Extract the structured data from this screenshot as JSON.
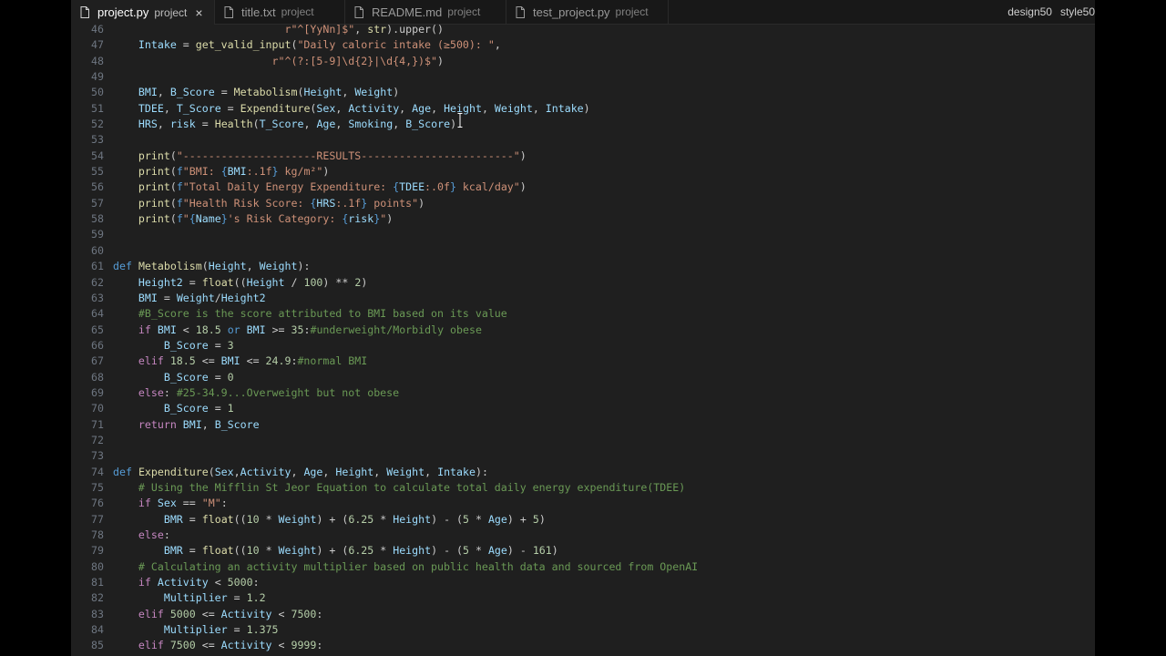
{
  "tabs": [
    {
      "name": "project.py",
      "desc": "project",
      "active": true
    },
    {
      "name": "title.txt",
      "desc": "project",
      "active": false
    },
    {
      "name": "README.md",
      "desc": "project",
      "active": false
    },
    {
      "name": "test_project.py",
      "desc": "project",
      "active": false
    }
  ],
  "header_right": [
    "design50",
    "style50"
  ],
  "close_glyph": "×",
  "code_lines": [
    {
      "n": "46",
      "t": [
        [
          "s",
          "                           r\"^[YyNn]$\""
        ],
        [
          "p",
          ", "
        ],
        [
          "f",
          "str"
        ],
        [
          "p",
          ").upper()"
        ]
      ]
    },
    {
      "n": "47",
      "t": [
        [
          "p",
          "    "
        ],
        [
          "v",
          "Intake"
        ],
        [
          "p",
          " = "
        ],
        [
          "f",
          "get_valid_input"
        ],
        [
          "p",
          "("
        ],
        [
          "s",
          "\"Daily caloric intake (≥500): \""
        ],
        [
          "p",
          ","
        ]
      ]
    },
    {
      "n": "48",
      "t": [
        [
          "p",
          "                         "
        ],
        [
          "s",
          "r\"^(?:[5-9]\\d{2}|\\d{4,})$\""
        ],
        [
          "p",
          ")"
        ]
      ]
    },
    {
      "n": "49",
      "t": []
    },
    {
      "n": "50",
      "t": [
        [
          "p",
          "    "
        ],
        [
          "v",
          "BMI"
        ],
        [
          "p",
          ", "
        ],
        [
          "v",
          "B_Score"
        ],
        [
          "p",
          " = "
        ],
        [
          "f",
          "Metabolism"
        ],
        [
          "p",
          "("
        ],
        [
          "v",
          "Height"
        ],
        [
          "p",
          ", "
        ],
        [
          "v",
          "Weight"
        ],
        [
          "p",
          ")"
        ]
      ]
    },
    {
      "n": "51",
      "t": [
        [
          "p",
          "    "
        ],
        [
          "v",
          "TDEE"
        ],
        [
          "p",
          ", "
        ],
        [
          "v",
          "T_Score"
        ],
        [
          "p",
          " = "
        ],
        [
          "f",
          "Expenditure"
        ],
        [
          "p",
          "("
        ],
        [
          "v",
          "Sex"
        ],
        [
          "p",
          ", "
        ],
        [
          "v",
          "Activity"
        ],
        [
          "p",
          ", "
        ],
        [
          "v",
          "Age"
        ],
        [
          "p",
          ", "
        ],
        [
          "v",
          "Height"
        ],
        [
          "p",
          ", "
        ],
        [
          "v",
          "Weight"
        ],
        [
          "p",
          ", "
        ],
        [
          "v",
          "Intake"
        ],
        [
          "p",
          ")"
        ]
      ]
    },
    {
      "n": "52",
      "t": [
        [
          "p",
          "    "
        ],
        [
          "v",
          "HRS"
        ],
        [
          "p",
          ", "
        ],
        [
          "v",
          "risk"
        ],
        [
          "p",
          " = "
        ],
        [
          "f",
          "Health"
        ],
        [
          "p",
          "("
        ],
        [
          "v",
          "T_Score"
        ],
        [
          "p",
          ", "
        ],
        [
          "v",
          "Age"
        ],
        [
          "p",
          ", "
        ],
        [
          "v",
          "Smoking"
        ],
        [
          "p",
          ", "
        ],
        [
          "v",
          "B_Score"
        ],
        [
          "p",
          ")"
        ]
      ]
    },
    {
      "n": "53",
      "t": []
    },
    {
      "n": "54",
      "t": [
        [
          "p",
          "    "
        ],
        [
          "f",
          "print"
        ],
        [
          "p",
          "("
        ],
        [
          "s",
          "\"---------------------RESULTS------------------------\""
        ],
        [
          "p",
          ")"
        ]
      ]
    },
    {
      "n": "55",
      "t": [
        [
          "p",
          "    "
        ],
        [
          "f",
          "print"
        ],
        [
          "p",
          "("
        ],
        [
          "k",
          "f"
        ],
        [
          "s",
          "\"BMI: "
        ],
        [
          "k",
          "{"
        ],
        [
          "v",
          "BMI"
        ],
        [
          "s",
          ":.1f"
        ],
        [
          "k",
          "}"
        ],
        [
          "s",
          " kg/m²\""
        ],
        [
          "p",
          ")"
        ]
      ]
    },
    {
      "n": "56",
      "t": [
        [
          "p",
          "    "
        ],
        [
          "f",
          "print"
        ],
        [
          "p",
          "("
        ],
        [
          "k",
          "f"
        ],
        [
          "s",
          "\"Total Daily Energy Expenditure: "
        ],
        [
          "k",
          "{"
        ],
        [
          "v",
          "TDEE"
        ],
        [
          "s",
          ":.0f"
        ],
        [
          "k",
          "}"
        ],
        [
          "s",
          " kcal/day\""
        ],
        [
          "p",
          ")"
        ]
      ]
    },
    {
      "n": "57",
      "t": [
        [
          "p",
          "    "
        ],
        [
          "f",
          "print"
        ],
        [
          "p",
          "("
        ],
        [
          "k",
          "f"
        ],
        [
          "s",
          "\"Health Risk Score: "
        ],
        [
          "k",
          "{"
        ],
        [
          "v",
          "HRS"
        ],
        [
          "s",
          ":.1f"
        ],
        [
          "k",
          "}"
        ],
        [
          "s",
          " points\""
        ],
        [
          "p",
          ")"
        ]
      ]
    },
    {
      "n": "58",
      "t": [
        [
          "p",
          "    "
        ],
        [
          "f",
          "print"
        ],
        [
          "p",
          "("
        ],
        [
          "k",
          "f"
        ],
        [
          "s",
          "\""
        ],
        [
          "k",
          "{"
        ],
        [
          "v",
          "Name"
        ],
        [
          "k",
          "}"
        ],
        [
          "s",
          "'s Risk Category: "
        ],
        [
          "k",
          "{"
        ],
        [
          "v",
          "risk"
        ],
        [
          "k",
          "}"
        ],
        [
          "s",
          "\""
        ],
        [
          "p",
          ")"
        ]
      ]
    },
    {
      "n": "59",
      "t": []
    },
    {
      "n": "60",
      "t": []
    },
    {
      "n": "61",
      "t": [
        [
          "k",
          "def"
        ],
        [
          "p",
          " "
        ],
        [
          "f",
          "Metabolism"
        ],
        [
          "p",
          "("
        ],
        [
          "v",
          "Height"
        ],
        [
          "p",
          ", "
        ],
        [
          "v",
          "Weight"
        ],
        [
          "p",
          "):"
        ]
      ]
    },
    {
      "n": "62",
      "t": [
        [
          "p",
          "    "
        ],
        [
          "v",
          "Height2"
        ],
        [
          "p",
          " = "
        ],
        [
          "f",
          "float"
        ],
        [
          "p",
          "(("
        ],
        [
          "v",
          "Height"
        ],
        [
          "p",
          " / "
        ],
        [
          "n",
          "100"
        ],
        [
          "p",
          ") ** "
        ],
        [
          "n",
          "2"
        ],
        [
          "p",
          ")"
        ]
      ]
    },
    {
      "n": "63",
      "t": [
        [
          "p",
          "    "
        ],
        [
          "v",
          "BMI"
        ],
        [
          "p",
          " = "
        ],
        [
          "v",
          "Weight"
        ],
        [
          "p",
          "/"
        ],
        [
          "v",
          "Height2"
        ]
      ]
    },
    {
      "n": "64",
      "t": [
        [
          "p",
          "    "
        ],
        [
          "m",
          "#B_Score is the score attributed to BMI based on its value"
        ]
      ]
    },
    {
      "n": "65",
      "t": [
        [
          "p",
          "    "
        ],
        [
          "c",
          "if"
        ],
        [
          "p",
          " "
        ],
        [
          "v",
          "BMI"
        ],
        [
          "p",
          " < "
        ],
        [
          "n",
          "18.5"
        ],
        [
          "p",
          " "
        ],
        [
          "k",
          "or"
        ],
        [
          "p",
          " "
        ],
        [
          "v",
          "BMI"
        ],
        [
          "p",
          " >= "
        ],
        [
          "n",
          "35"
        ],
        [
          "p",
          ":"
        ],
        [
          "m",
          "#underweight/Morbidly obese"
        ]
      ]
    },
    {
      "n": "66",
      "t": [
        [
          "p",
          "        "
        ],
        [
          "v",
          "B_Score"
        ],
        [
          "p",
          " = "
        ],
        [
          "n",
          "3"
        ]
      ]
    },
    {
      "n": "67",
      "t": [
        [
          "p",
          "    "
        ],
        [
          "c",
          "elif"
        ],
        [
          "p",
          " "
        ],
        [
          "n",
          "18.5"
        ],
        [
          "p",
          " <= "
        ],
        [
          "v",
          "BMI"
        ],
        [
          "p",
          " <= "
        ],
        [
          "n",
          "24.9"
        ],
        [
          "p",
          ":"
        ],
        [
          "m",
          "#normal BMI"
        ]
      ]
    },
    {
      "n": "68",
      "t": [
        [
          "p",
          "        "
        ],
        [
          "v",
          "B_Score"
        ],
        [
          "p",
          " = "
        ],
        [
          "n",
          "0"
        ]
      ]
    },
    {
      "n": "69",
      "t": [
        [
          "p",
          "    "
        ],
        [
          "c",
          "else"
        ],
        [
          "p",
          ": "
        ],
        [
          "m",
          "#25-34.9...Overweight but not obese"
        ]
      ]
    },
    {
      "n": "70",
      "t": [
        [
          "p",
          "        "
        ],
        [
          "v",
          "B_Score"
        ],
        [
          "p",
          " = "
        ],
        [
          "n",
          "1"
        ]
      ]
    },
    {
      "n": "71",
      "t": [
        [
          "p",
          "    "
        ],
        [
          "c",
          "return"
        ],
        [
          "p",
          " "
        ],
        [
          "v",
          "BMI"
        ],
        [
          "p",
          ", "
        ],
        [
          "v",
          "B_Score"
        ]
      ]
    },
    {
      "n": "72",
      "t": []
    },
    {
      "n": "73",
      "t": []
    },
    {
      "n": "74",
      "t": [
        [
          "k",
          "def"
        ],
        [
          "p",
          " "
        ],
        [
          "f",
          "Expenditure"
        ],
        [
          "p",
          "("
        ],
        [
          "v",
          "Sex"
        ],
        [
          "p",
          ","
        ],
        [
          "v",
          "Activity"
        ],
        [
          "p",
          ", "
        ],
        [
          "v",
          "Age"
        ],
        [
          "p",
          ", "
        ],
        [
          "v",
          "Height"
        ],
        [
          "p",
          ", "
        ],
        [
          "v",
          "Weight"
        ],
        [
          "p",
          ", "
        ],
        [
          "v",
          "Intake"
        ],
        [
          "p",
          "):"
        ]
      ]
    },
    {
      "n": "75",
      "t": [
        [
          "p",
          "    "
        ],
        [
          "m",
          "# Using the Mifflin St Jeor Equation to calculate total daily energy expenditure(TDEE)"
        ]
      ]
    },
    {
      "n": "76",
      "t": [
        [
          "p",
          "    "
        ],
        [
          "c",
          "if"
        ],
        [
          "p",
          " "
        ],
        [
          "v",
          "Sex"
        ],
        [
          "p",
          " == "
        ],
        [
          "s",
          "\"M\""
        ],
        [
          "p",
          ":"
        ]
      ]
    },
    {
      "n": "77",
      "t": [
        [
          "p",
          "        "
        ],
        [
          "v",
          "BMR"
        ],
        [
          "p",
          " = "
        ],
        [
          "f",
          "float"
        ],
        [
          "p",
          "(("
        ],
        [
          "n",
          "10"
        ],
        [
          "p",
          " * "
        ],
        [
          "v",
          "Weight"
        ],
        [
          "p",
          ") + ("
        ],
        [
          "n",
          "6.25"
        ],
        [
          "p",
          " * "
        ],
        [
          "v",
          "Height"
        ],
        [
          "p",
          ") - ("
        ],
        [
          "n",
          "5"
        ],
        [
          "p",
          " * "
        ],
        [
          "v",
          "Age"
        ],
        [
          "p",
          ") + "
        ],
        [
          "n",
          "5"
        ],
        [
          "p",
          ")"
        ]
      ]
    },
    {
      "n": "78",
      "t": [
        [
          "p",
          "    "
        ],
        [
          "c",
          "else"
        ],
        [
          "p",
          ":"
        ]
      ]
    },
    {
      "n": "79",
      "t": [
        [
          "p",
          "        "
        ],
        [
          "v",
          "BMR"
        ],
        [
          "p",
          " = "
        ],
        [
          "f",
          "float"
        ],
        [
          "p",
          "(("
        ],
        [
          "n",
          "10"
        ],
        [
          "p",
          " * "
        ],
        [
          "v",
          "Weight"
        ],
        [
          "p",
          ") + ("
        ],
        [
          "n",
          "6.25"
        ],
        [
          "p",
          " * "
        ],
        [
          "v",
          "Height"
        ],
        [
          "p",
          ") - ("
        ],
        [
          "n",
          "5"
        ],
        [
          "p",
          " * "
        ],
        [
          "v",
          "Age"
        ],
        [
          "p",
          ") - "
        ],
        [
          "n",
          "161"
        ],
        [
          "p",
          ")"
        ]
      ]
    },
    {
      "n": "80",
      "t": [
        [
          "p",
          "    "
        ],
        [
          "m",
          "# Calculating an activity multiplier based on public health data and sourced from OpenAI"
        ]
      ]
    },
    {
      "n": "81",
      "t": [
        [
          "p",
          "    "
        ],
        [
          "c",
          "if"
        ],
        [
          "p",
          " "
        ],
        [
          "v",
          "Activity"
        ],
        [
          "p",
          " < "
        ],
        [
          "n",
          "5000"
        ],
        [
          "p",
          ":"
        ]
      ]
    },
    {
      "n": "82",
      "t": [
        [
          "p",
          "        "
        ],
        [
          "v",
          "Multiplier"
        ],
        [
          "p",
          " = "
        ],
        [
          "n",
          "1.2"
        ]
      ]
    },
    {
      "n": "83",
      "t": [
        [
          "p",
          "    "
        ],
        [
          "c",
          "elif"
        ],
        [
          "p",
          " "
        ],
        [
          "n",
          "5000"
        ],
        [
          "p",
          " <= "
        ],
        [
          "v",
          "Activity"
        ],
        [
          "p",
          " < "
        ],
        [
          "n",
          "7500"
        ],
        [
          "p",
          ":"
        ]
      ]
    },
    {
      "n": "84",
      "t": [
        [
          "p",
          "        "
        ],
        [
          "v",
          "Multiplier"
        ],
        [
          "p",
          " = "
        ],
        [
          "n",
          "1.375"
        ]
      ]
    },
    {
      "n": "85",
      "t": [
        [
          "p",
          "    "
        ],
        [
          "c",
          "elif"
        ],
        [
          "p",
          " "
        ],
        [
          "n",
          "7500"
        ],
        [
          "p",
          " <= "
        ],
        [
          "v",
          "Activity"
        ],
        [
          "p",
          " < "
        ],
        [
          "n",
          "9999"
        ],
        [
          "p",
          ":"
        ]
      ]
    }
  ]
}
